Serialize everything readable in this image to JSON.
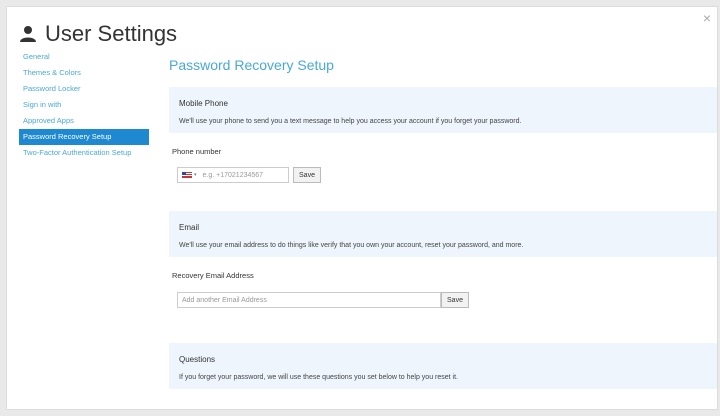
{
  "window": {
    "title": "User Settings",
    "close_glyph": "×"
  },
  "sidebar": {
    "items": [
      {
        "label": "General",
        "active": false
      },
      {
        "label": "Themes & Colors",
        "active": false
      },
      {
        "label": "Password Locker",
        "active": false
      },
      {
        "label": "Sign in with",
        "active": false
      },
      {
        "label": "Approved Apps",
        "active": false
      },
      {
        "label": "Password Recovery Setup",
        "active": true
      },
      {
        "label": "Two-Factor Authentication Setup",
        "active": false
      }
    ]
  },
  "main": {
    "title": "Password Recovery Setup",
    "mobile": {
      "title": "Mobile Phone",
      "description": "We'll use your phone to send you a text message to help you access your account if you forget your password.",
      "field_label": "Phone number",
      "placeholder": "e.g. +17021234567",
      "save_label": "Save"
    },
    "email": {
      "title": "Email",
      "description": "We'll use your email address to do things like verify that you own your account, reset your password, and more.",
      "field_label": "Recovery Email Address",
      "placeholder": "Add another Email Address",
      "save_label": "Save"
    },
    "questions": {
      "title": "Questions",
      "description": "If you forget your password, we will use these questions you set below to help you reset it."
    }
  },
  "colors": {
    "accent": "#4aa8d8",
    "active_bg": "#1e88d0",
    "card_bg": "#eef5fc"
  },
  "icons": {
    "user": "user-icon",
    "close": "close-icon",
    "flag": "us-flag-icon"
  }
}
